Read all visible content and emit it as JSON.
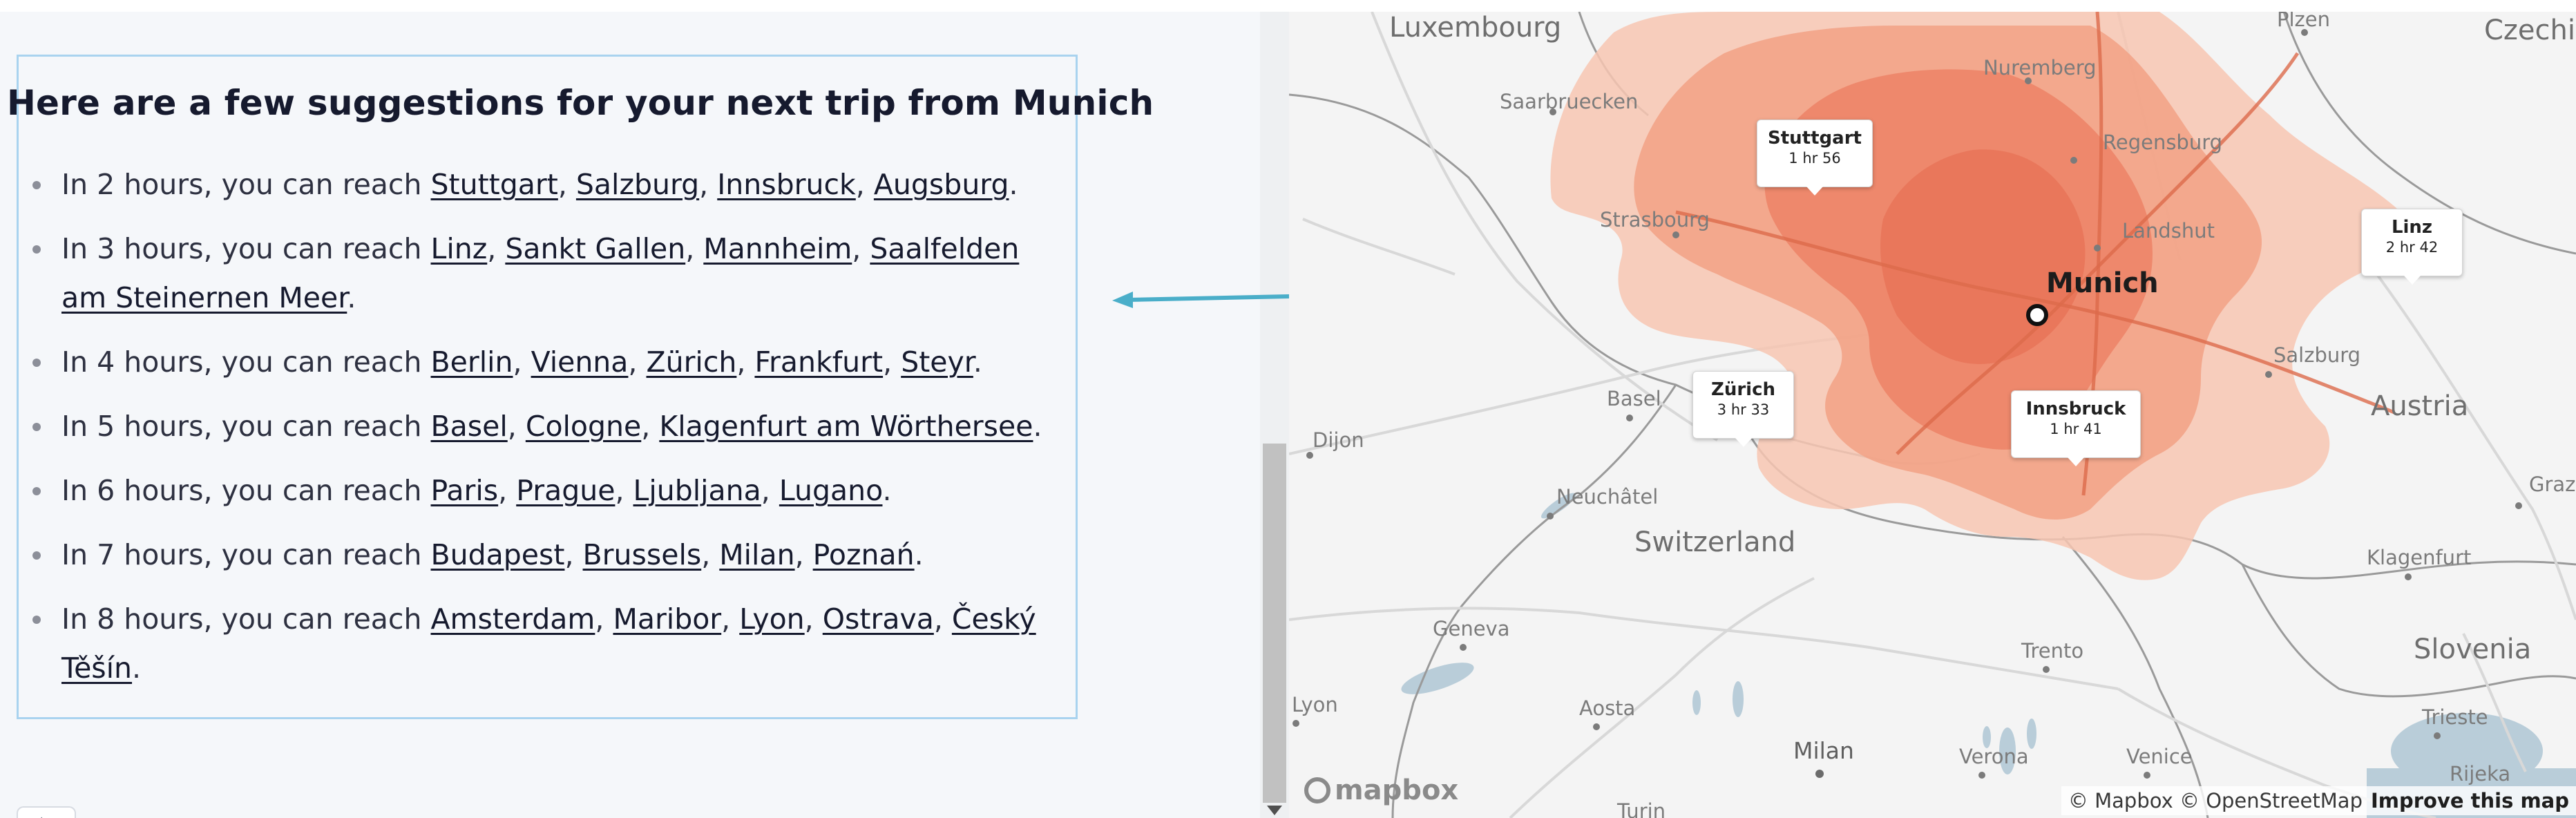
{
  "suggestions": {
    "title": "Here are a few suggestions for your next trip from Munich",
    "rows": [
      {
        "prefix": "In 2 hours, you can reach",
        "cities": [
          "Stuttgart",
          "Salzburg",
          "Innsbruck",
          "Augsburg"
        ]
      },
      {
        "prefix": "In 3 hours, you can reach",
        "cities": [
          "Linz",
          "Sankt Gallen",
          "Mannheim",
          "Saalfelden am Steinernen Meer"
        ]
      },
      {
        "prefix": "In 4 hours, you can reach",
        "cities": [
          "Berlin",
          "Vienna",
          "Zürich",
          "Frankfurt",
          "Steyr"
        ]
      },
      {
        "prefix": "In 5 hours, you can reach",
        "cities": [
          "Basel",
          "Cologne",
          "Klagenfurt am Wörthersee"
        ]
      },
      {
        "prefix": "In 6 hours, you can reach",
        "cities": [
          "Paris",
          "Prague",
          "Ljubljana",
          "Lugano"
        ]
      },
      {
        "prefix": "In 7 hours, you can reach",
        "cities": [
          "Budapest",
          "Brussels",
          "Milan",
          "Poznań"
        ]
      },
      {
        "prefix": "In 8 hours, you can reach",
        "cities": [
          "Amsterdam",
          "Maribor",
          "Lyon",
          "Ostrava",
          "Český Těšín"
        ]
      }
    ]
  },
  "panel": {
    "collapse_glyph": "‹"
  },
  "map": {
    "origin": "Munich",
    "callouts": [
      {
        "name": "Stuttgart",
        "time": "1 hr 56"
      },
      {
        "name": "Linz",
        "time": "2 hr 42"
      },
      {
        "name": "Zürich",
        "time": "3 hr 33"
      },
      {
        "name": "Innsbruck",
        "time": "1 hr 41"
      }
    ],
    "countries": [
      "Luxembourg",
      "Czechia",
      "Switzerland",
      "Austria",
      "Slovenia"
    ],
    "cities": [
      "Saarbruecken",
      "Nuremberg",
      "Plzen",
      "Regensburg",
      "Strasbourg",
      "Landshut",
      "Salzburg",
      "Basel",
      "Dijon",
      "Neuchâtel",
      "Graz",
      "Klagenfurt",
      "Geneva",
      "Trento",
      "Lyon",
      "Aosta",
      "Trieste",
      "Verona",
      "Venice",
      "Rijeka",
      "Turin"
    ],
    "big_cities": [
      "Milan"
    ],
    "logo_text": "mapbox",
    "attribution": "© Mapbox © OpenStreetMap",
    "improve_link": "Improve this map",
    "colors": {
      "isochrone_outer": "#f7c5b1",
      "isochrone_mid": "#f2a185",
      "isochrone_inner": "#ec7d62",
      "land": "#f4f4f4",
      "water": "#b9cdd9",
      "arrow": "#4aaec9",
      "box_border": "#a9d3ef"
    }
  }
}
